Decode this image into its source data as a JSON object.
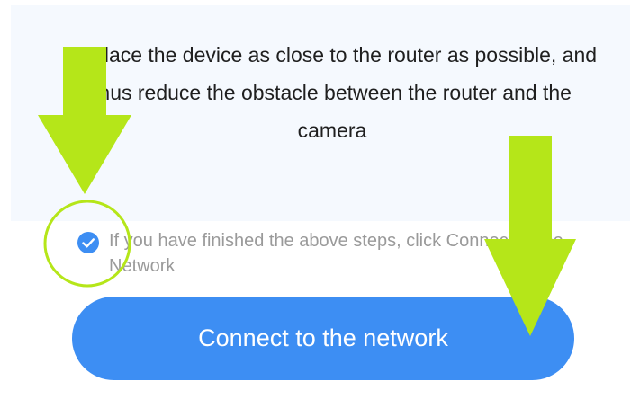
{
  "instructions": {
    "step_text": "3. Place the device as close to the router as possible, and thus reduce the obstacle between the router and the camera"
  },
  "confirmation": {
    "checked": true,
    "label": "If you have finished the above steps, click Connect to the Network"
  },
  "actions": {
    "connect_label": "Connect to the network"
  },
  "colors": {
    "accent_blue": "#3d8ef3",
    "annotation_green": "#b5e619",
    "panel_background": "#f5f9fe",
    "label_gray": "#9a9a9a"
  },
  "icons": {
    "checkbox": "checkmark-icon",
    "annotation": "down-arrow-icon"
  }
}
